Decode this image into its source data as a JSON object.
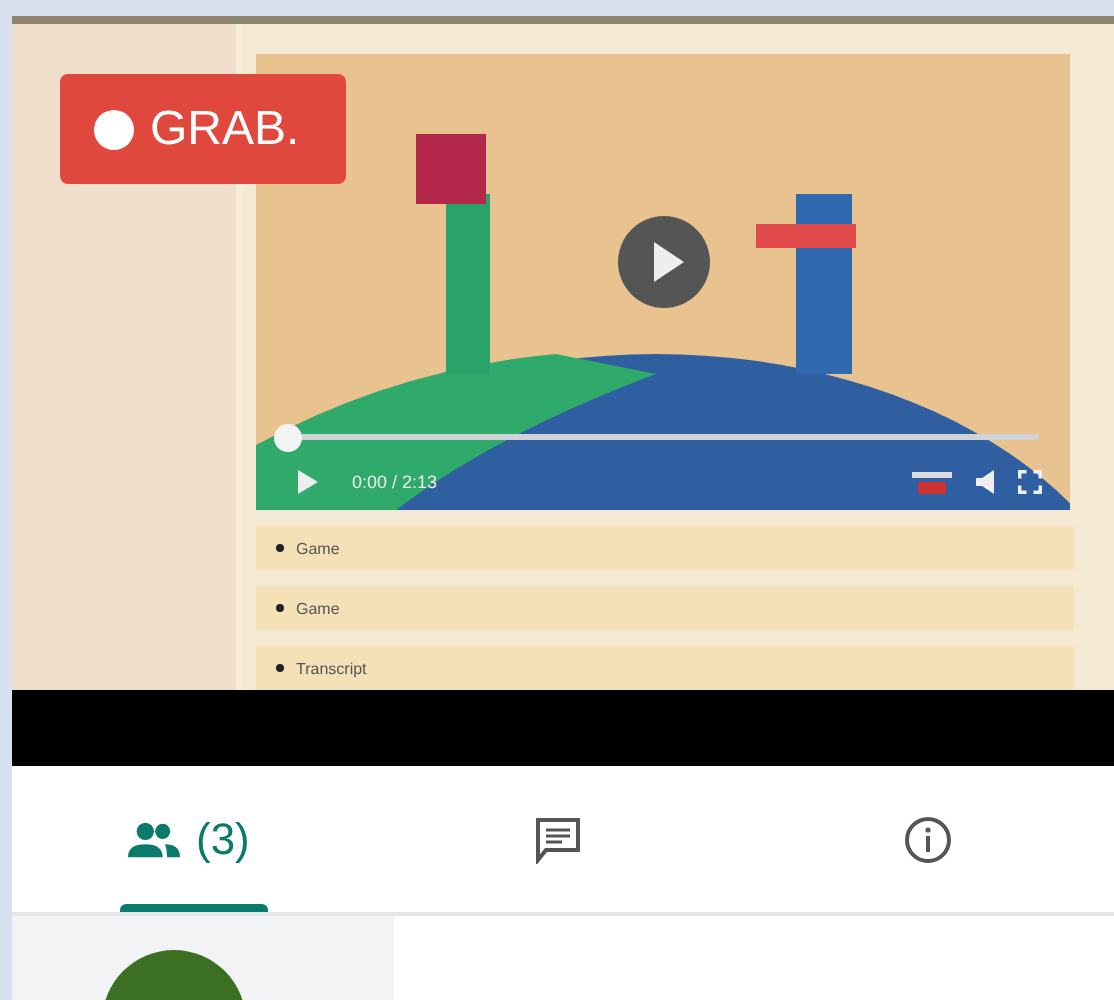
{
  "recording_badge": {
    "label": "GRAB."
  },
  "shared_screen": {
    "video": {
      "progress": {
        "level": 0
      },
      "time": "0:00 / 2:13"
    },
    "sections": [
      {
        "label": "Game"
      },
      {
        "label": "Game"
      },
      {
        "label": "Transcript"
      }
    ]
  },
  "tabs": [
    {
      "kind": "people",
      "label": "(3)",
      "selected": true
    },
    {
      "kind": "chat",
      "selected": false
    },
    {
      "kind": "info",
      "selected": false
    }
  ]
}
